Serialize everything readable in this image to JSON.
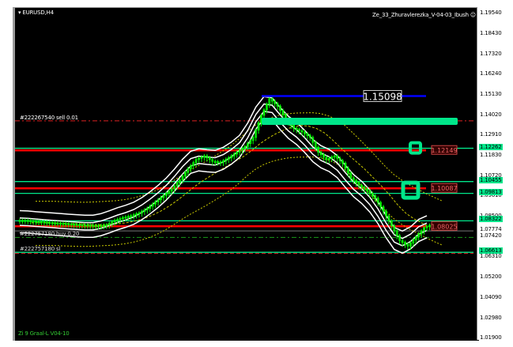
{
  "chart": {
    "symbol_label": "EURUSD,H4",
    "expert_label": "Ze_33_Zhuravlerezka_V-04-03_Ibush",
    "smiley_icon": "smiley-face-icon",
    "indicator_label": "Zi 9 Graal-L V04-10",
    "background": "#000000"
  },
  "orders": {
    "sell_label": "#222267540 sell 0.01",
    "sell_price": 1.1375,
    "buy_label": "#222757180 buy 0.20",
    "buy_price": 1.0742,
    "sl_label": "#222757180 sl",
    "sl_price": 1.0655
  },
  "levels": {
    "high_marker": {
      "label": "1.15098",
      "price": 1.15098,
      "color": "#0000ff"
    },
    "cyan_lines": [
      {
        "label": "1.12262",
        "price": 1.12262
      },
      {
        "label": "1.10455",
        "price": 1.10455
      },
      {
        "label": "1.09813",
        "price": 1.09813
      },
      {
        "label": "1.08322",
        "price": 1.08322
      },
      {
        "label": "1.06613",
        "price": 1.06613
      }
    ],
    "red_lines": [
      {
        "label": "1.12149",
        "price": 1.12149
      },
      {
        "label": "1.10087",
        "price": 1.10087
      },
      {
        "label": "1.08025",
        "price": 1.08025
      }
    ],
    "current_price": {
      "label": "1.07774",
      "price": 1.07774
    },
    "colors": {
      "cyan": "#00e68a",
      "red": "#ff0000",
      "candle": "#00ff00",
      "band": "#ffffff",
      "dotted": "#c8c800"
    }
  },
  "axis": {
    "ticks": [
      "1.19540",
      "1.18430",
      "1.17320",
      "1.16240",
      "1.15130",
      "1.14020",
      "1.12910",
      "1.11830",
      "1.10720",
      "1.09610",
      "1.08500",
      "1.07420",
      "1.06310",
      "1.05200",
      "1.04090",
      "1.02980",
      "1.01900"
    ]
  },
  "chart_data": {
    "type": "candlestick",
    "ylim": [
      1.019,
      1.1954
    ],
    "closes": [
      1.083,
      1.0825,
      1.0822,
      1.0818,
      1.0815,
      1.0812,
      1.0808,
      1.0805,
      1.0803,
      1.08,
      1.0805,
      1.083,
      1.0845,
      1.0855,
      1.087,
      1.0895,
      1.093,
      1.0965,
      1.1,
      1.105,
      1.111,
      1.116,
      1.118,
      1.115,
      1.1145,
      1.117,
      1.12,
      1.123,
      1.128,
      1.14,
      1.149,
      1.145,
      1.138,
      1.133,
      1.131,
      1.128,
      1.12,
      1.116,
      1.118,
      1.114,
      1.106,
      1.102,
      1.099,
      1.095,
      1.088,
      1.08,
      1.072,
      1.069,
      1.074,
      1.079,
      1.081
    ]
  }
}
